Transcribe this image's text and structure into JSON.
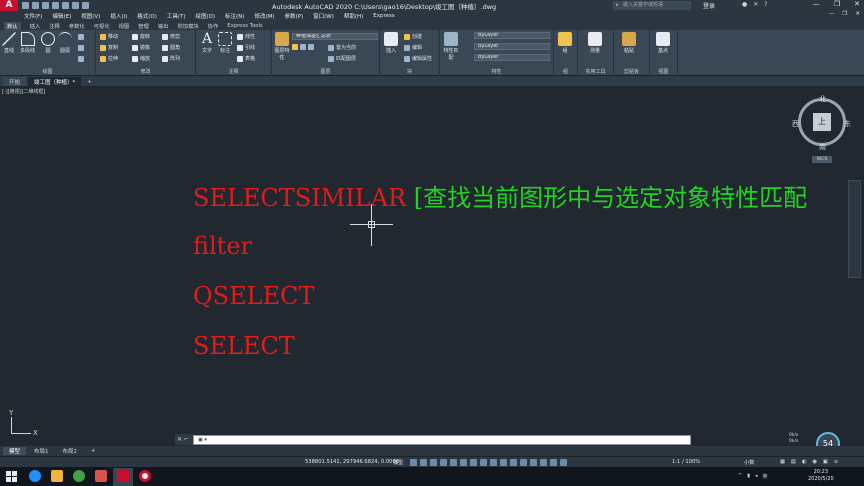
{
  "titlebar": {
    "title": "Autodesk AutoCAD 2020    C:\\Users\\gao16\\Desktop\\竣工图（种植）.dwg",
    "search_placeholder": "键入关键字或短语",
    "login_label": "登录"
  },
  "menu": {
    "items": [
      "文件(F)",
      "编辑(E)",
      "视图(V)",
      "插入(I)",
      "格式(O)",
      "工具(T)",
      "绘图(D)",
      "标注(N)",
      "修改(M)",
      "参数(P)",
      "窗口(W)",
      "帮助(H)",
      "Express"
    ]
  },
  "ribbon_tabs": [
    "默认",
    "插入",
    "注释",
    "参数化",
    "可视化",
    "视图",
    "管理",
    "输出",
    "附加模块",
    "协作",
    "Express Tools"
  ],
  "ribbon": {
    "draw": {
      "label": "绘图",
      "line": "直线",
      "polyline": "多段线",
      "circle": "圆",
      "arc": "圆弧"
    },
    "modify": {
      "label": "修改",
      "move": "移动",
      "rotate": "旋转",
      "trim": "修剪",
      "copy": "复制",
      "mirror": "镜像",
      "fillet": "圆角",
      "stretch": "拉伸",
      "scale": "缩放",
      "array": "阵列"
    },
    "annotation": {
      "label": "注释",
      "text": "文字",
      "dimension": "标注",
      "linear": "线性",
      "leader": "引线",
      "table": "表格"
    },
    "layers": {
      "label": "图层",
      "current_layer": "种植油墨汇总表",
      "layer_props": "图层特性",
      "make_current": "置为当前",
      "match_layer": "匹配图层"
    },
    "block": {
      "label": "块",
      "insert": "插入",
      "create": "创建",
      "edit": "编辑",
      "edit_attr": "编辑属性"
    },
    "properties": {
      "label": "特性",
      "match": "特性匹配",
      "color": "ByLayer",
      "linetype": "ByLayer",
      "lineweight": "ByLayer"
    },
    "groups": {
      "label": "组",
      "group": "组"
    },
    "utilities": {
      "label": "实用工具",
      "measure": "测量"
    },
    "clipboard": {
      "label": "剪贴板",
      "paste": "粘贴"
    },
    "view": {
      "label": "视图",
      "base": "基点"
    }
  },
  "file_tabs": [
    "开始",
    "竣工图（种植）*"
  ],
  "viewport": {
    "label": "[-][俯视][二维线框]"
  },
  "canvas_text": {
    "line1_cmd": "SELECTSIMILAR",
    "line1_desc": "[查找当前图形中与选定对象特性匹配",
    "line2": "filter",
    "line3": "QSELECT",
    "line4": "SELECT"
  },
  "viewcube": {
    "north": "北",
    "south": "南",
    "east": "东",
    "west": "西",
    "face": "上",
    "wcs": "WCS"
  },
  "ucs": {
    "x": "X",
    "y": "Y"
  },
  "command": {
    "handle": "✕ ⌐",
    "prompt": "▣ ▾"
  },
  "layout_tabs": [
    "模型",
    "布局1",
    "布局2",
    "+"
  ],
  "status": {
    "coordinates": "538801.5141, 297946.6824, 0.0000",
    "model": "模型",
    "scale": "1:1 / 100%",
    "units": "小数"
  },
  "overlay": {
    "fps": "54",
    "rate1": "0k/s",
    "rate2": "0k/s"
  },
  "taskbar": {
    "clock_time": "20:23",
    "clock_date": "2020/5/20",
    "ime": "英"
  },
  "colors": {
    "canvas_bg": "#212830",
    "command_red": "#e21b1b",
    "desc_green": "#22d322"
  }
}
